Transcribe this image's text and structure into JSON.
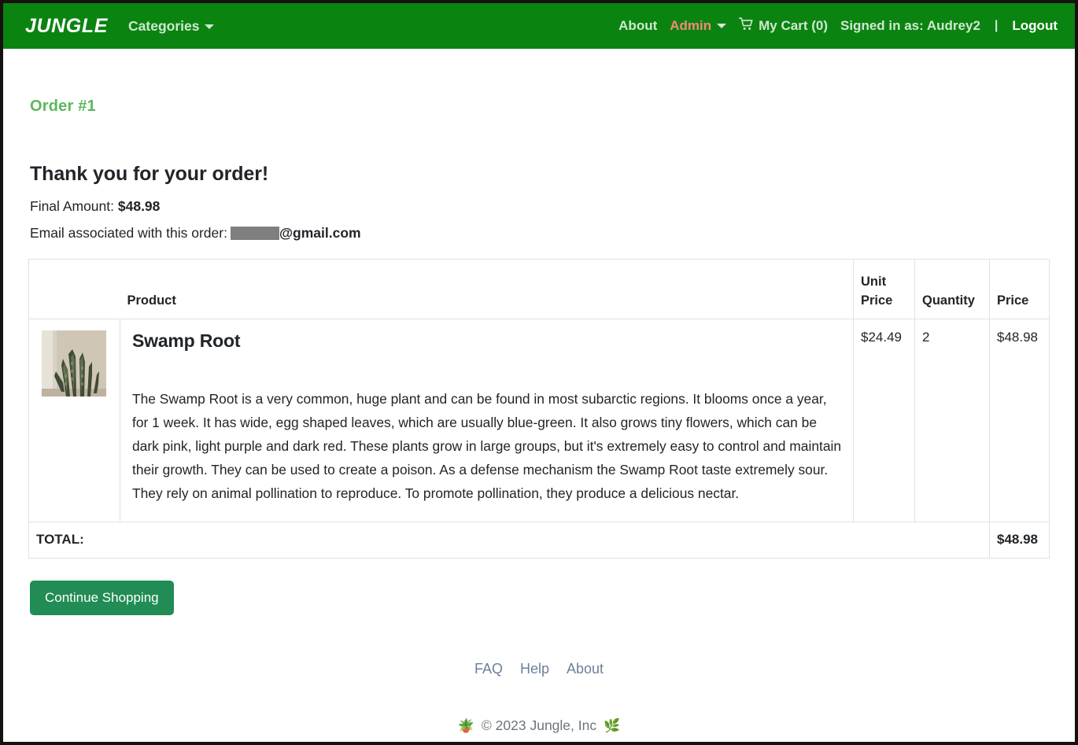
{
  "navbar": {
    "brand": "JUNGLE",
    "categories_label": "Categories",
    "about_label": "About",
    "admin_label": "Admin",
    "cart_label": "My Cart (0)",
    "cart_icon": "shopping-cart-icon",
    "signed_in_label": "Signed in as: Audrey2",
    "pipe": "|",
    "logout_label": "Logout",
    "background_color": "#0b8311",
    "admin_color": "#f58a78",
    "link_color": "#cfe8cf"
  },
  "page": {
    "order_id": "Order #1",
    "order_id_color": "#5cb85c",
    "heading": "Thank you for your order!",
    "final_amount_label": "Final Amount:",
    "final_amount_value": "$48.98",
    "email_label": "Email associated with this order:",
    "email_domain": "@gmail.com",
    "email_redacted": true
  },
  "table": {
    "headers": {
      "image": "",
      "product": "Product",
      "unit_price": "Unit Price",
      "quantity": "Quantity",
      "price": "Price"
    },
    "rows": [
      {
        "image_alt": "swamp-root-plant-photo",
        "name": "Swamp Root",
        "description": "The Swamp Root is a very common, huge plant and can be found in most subarctic regions. It blooms once a year, for 1 week. It has wide, egg shaped leaves, which are usually blue-green. It also grows tiny flowers, which can be dark pink, light purple and dark red. These plants grow in large groups, but it's extremely easy to control and maintain their growth. They can be used to create a poison. As a defense mechanism the Swamp Root taste extremely sour. They rely on animal pollination to reproduce. To promote pollination, they produce a delicious nectar.",
        "unit_price": "$24.49",
        "quantity": "2",
        "price": "$48.98"
      }
    ],
    "total_label": "TOTAL:",
    "total_value": "$48.98"
  },
  "actions": {
    "continue_shopping": "Continue Shopping",
    "continue_shopping_color": "#218c53"
  },
  "footer": {
    "links": [
      "FAQ",
      "Help",
      "About"
    ],
    "potted_plant_emoji": "🪴",
    "copyright": "© 2023 Jungle, Inc",
    "herb_emoji": "🌿"
  }
}
